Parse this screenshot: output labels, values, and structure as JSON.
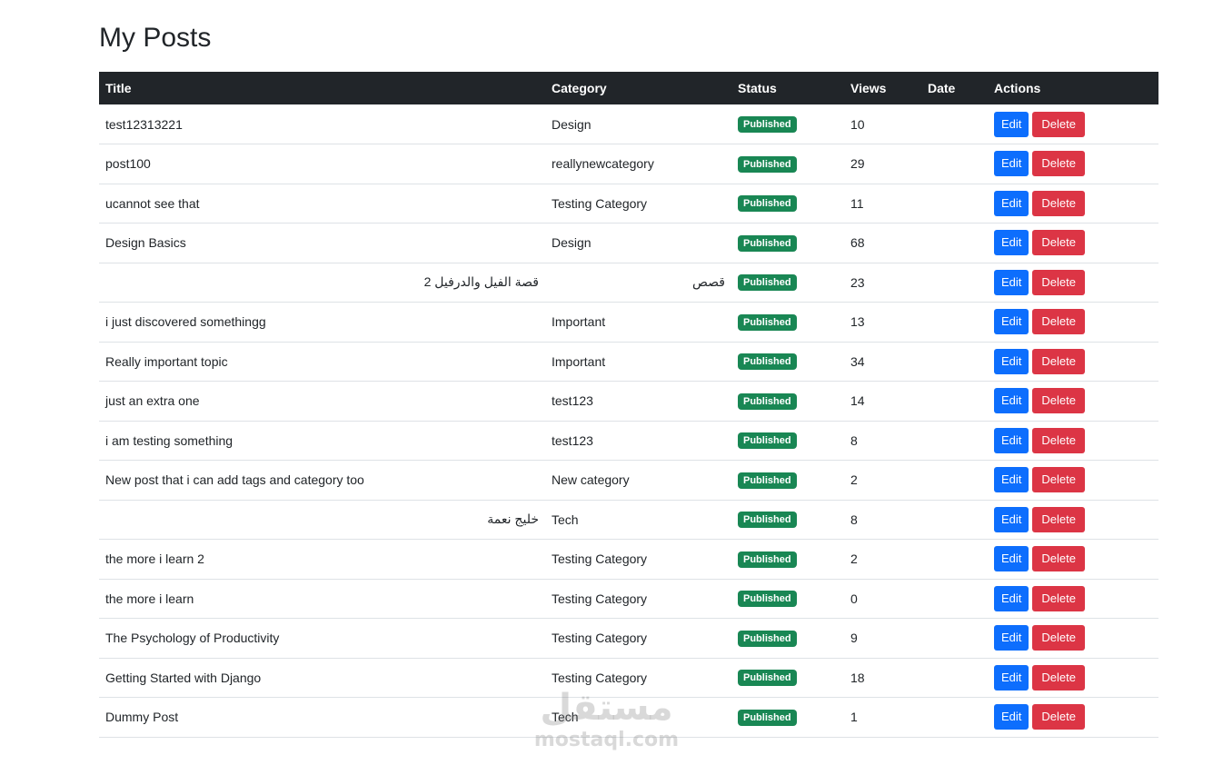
{
  "page": {
    "title": "My Posts"
  },
  "table": {
    "headers": [
      "Title",
      "Category",
      "Status",
      "Views",
      "Date",
      "Actions"
    ],
    "rows": [
      {
        "title": "test12313221",
        "category": "Design",
        "status": "Published",
        "views": "10",
        "date": ""
      },
      {
        "title": "post100",
        "category": "reallynewcategory",
        "status": "Published",
        "views": "29",
        "date": ""
      },
      {
        "title": "ucannot see that",
        "category": "Testing Category",
        "status": "Published",
        "views": "11",
        "date": ""
      },
      {
        "title": "Design Basics",
        "category": "Design",
        "status": "Published",
        "views": "68",
        "date": ""
      },
      {
        "title": "قصة الفيل والدرفيل 2",
        "category": "قصص",
        "status": "Published",
        "views": "23",
        "date": ""
      },
      {
        "title": "i just discovered somethingg",
        "category": "Important",
        "status": "Published",
        "views": "13",
        "date": ""
      },
      {
        "title": "Really important topic",
        "category": "Important",
        "status": "Published",
        "views": "34",
        "date": ""
      },
      {
        "title": "just an extra one",
        "category": "test123",
        "status": "Published",
        "views": "14",
        "date": ""
      },
      {
        "title": "i am testing something",
        "category": "test123",
        "status": "Published",
        "views": "8",
        "date": ""
      },
      {
        "title": "New post that i can add tags and category too",
        "category": "New category",
        "status": "Published",
        "views": "2",
        "date": ""
      },
      {
        "title": "خليج نعمة",
        "category": "Tech",
        "status": "Published",
        "views": "8",
        "date": ""
      },
      {
        "title": "the more i learn 2",
        "category": "Testing Category",
        "status": "Published",
        "views": "2",
        "date": ""
      },
      {
        "title": "the more i learn",
        "category": "Testing Category",
        "status": "Published",
        "views": "0",
        "date": ""
      },
      {
        "title": "The Psychology of Productivity",
        "category": "Testing Category",
        "status": "Published",
        "views": "9",
        "date": ""
      },
      {
        "title": "Getting Started with Django",
        "category": "Testing Category",
        "status": "Published",
        "views": "18",
        "date": ""
      },
      {
        "title": "Dummy Post",
        "category": "Tech",
        "status": "Published",
        "views": "1",
        "date": ""
      }
    ]
  },
  "actions": {
    "edit_label": "Edit",
    "delete_label": "Delete"
  },
  "watermark": {
    "arabic": "مستقل",
    "latin": "mostaql.com"
  },
  "colors": {
    "header_bg": "#212529",
    "badge_published": "#198754",
    "edit_button": "#0d6efd",
    "delete_button": "#dc3545"
  }
}
